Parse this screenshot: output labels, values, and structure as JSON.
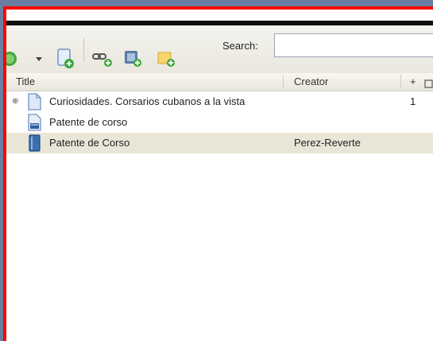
{
  "toolbar": {
    "search_label": "Search:",
    "search_value": ""
  },
  "columns": {
    "title": "Title",
    "creator": "Creator",
    "extra": "+"
  },
  "items": [
    {
      "title": "Curiosidades. Corsarios cubanos a la vista",
      "creator": "",
      "count": "1",
      "icon": "document-icon",
      "expandable": true
    },
    {
      "title": "Patente de corso",
      "creator": "",
      "count": "",
      "icon": "webpage-icon",
      "expandable": false
    },
    {
      "title": "Patente de Corso",
      "creator": "Perez-Reverte",
      "count": "",
      "icon": "book-icon",
      "expandable": false
    }
  ],
  "colors": {
    "frame_border": "#ff0000",
    "selected_row": "#e9e6d8",
    "accent_green": "#3ea83c"
  }
}
